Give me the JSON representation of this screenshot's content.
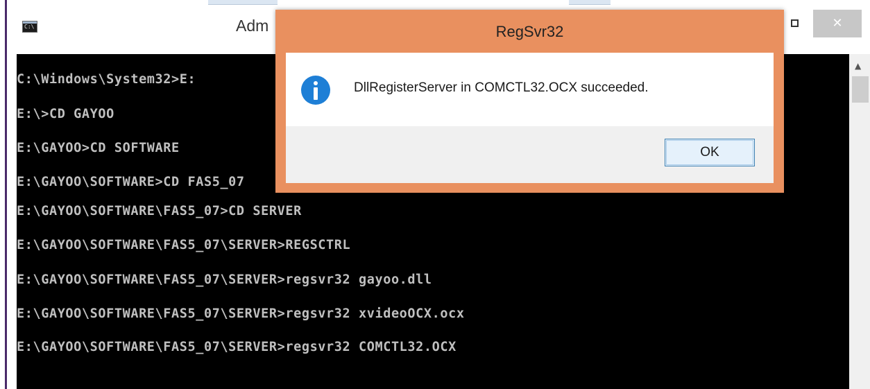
{
  "console": {
    "title": "Adm",
    "icon": "cmd-icon",
    "lines": [
      "C:\\Windows\\System32>E:",
      "E:\\>CD GAYOO",
      "E:\\GAYOO>CD SOFTWARE",
      "E:\\GAYOO\\SOFTWARE>CD FAS5_07",
      "E:\\GAYOO\\SOFTWARE\\FAS5_07>CD SERVER",
      "E:\\GAYOO\\SOFTWARE\\FAS5_07\\SERVER>REGSCTRL",
      "E:\\GAYOO\\SOFTWARE\\FAS5_07\\SERVER>regsvr32 gayoo.dll",
      "E:\\GAYOO\\SOFTWARE\\FAS5_07\\SERVER>regsvr32 xvideoOCX.ocx",
      "E:\\GAYOO\\SOFTWARE\\FAS5_07\\SERVER>regsvr32 COMCTL32.OCX"
    ],
    "close_label": "✕",
    "scroll_up": "▲"
  },
  "dialog": {
    "title": "RegSvr32",
    "icon": "info-icon",
    "message": "DllRegisterServer in COMCTL32.OCX succeeded.",
    "ok_label": "OK"
  },
  "colors": {
    "dialog_frame": "#e9905f",
    "console_bg": "#000000",
    "console_text": "#c0c0c0",
    "info_icon": "#1e7fd6"
  }
}
